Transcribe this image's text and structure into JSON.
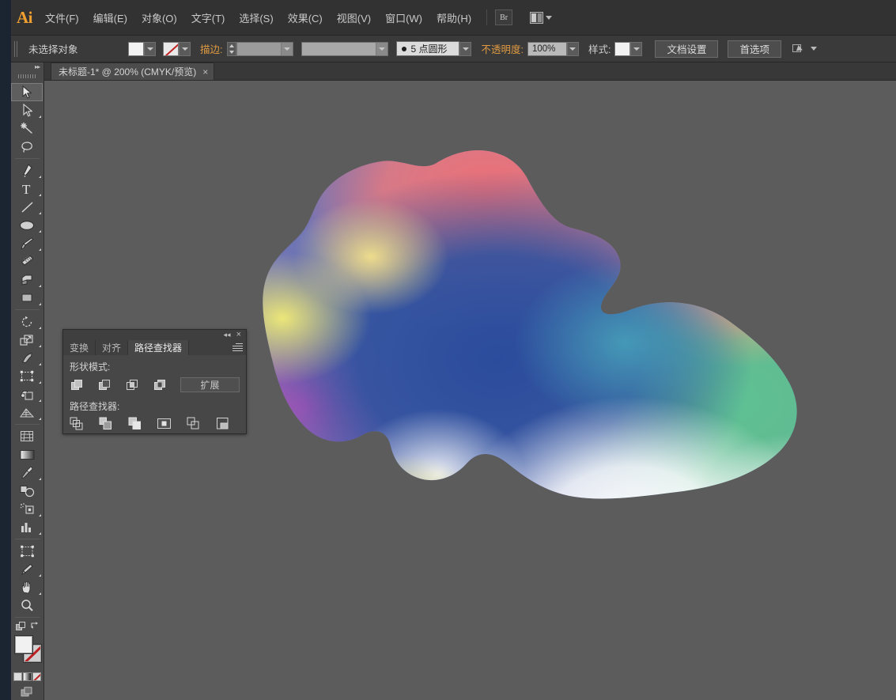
{
  "app": {
    "name": "Adobe Illustrator",
    "logo_text": "Ai"
  },
  "menubar": {
    "items": [
      {
        "label": "文件(F)",
        "name": "menu-file"
      },
      {
        "label": "编辑(E)",
        "name": "menu-edit"
      },
      {
        "label": "对象(O)",
        "name": "menu-object"
      },
      {
        "label": "文字(T)",
        "name": "menu-type"
      },
      {
        "label": "选择(S)",
        "name": "menu-select"
      },
      {
        "label": "效果(C)",
        "name": "menu-effect"
      },
      {
        "label": "视图(V)",
        "name": "menu-view"
      },
      {
        "label": "窗口(W)",
        "name": "menu-window"
      },
      {
        "label": "帮助(H)",
        "name": "menu-help"
      }
    ],
    "bridge_label": "Br",
    "arrange_label": ""
  },
  "controlbar": {
    "selection_status": "未选择对象",
    "stroke_label": "描边:",
    "stroke_weight": "",
    "profile_label": "5 点圆形",
    "opacity_label": "不透明度:",
    "opacity_value": "100%",
    "style_label": "样式:",
    "document_setup": "文档设置",
    "preferences": "首选项"
  },
  "tabbar": {
    "tabs": [
      {
        "title": "未标题-1* @ 200% (CMYK/预览)",
        "close": "×"
      }
    ]
  },
  "toolbar": {
    "collapse": "▸▸",
    "tools": [
      {
        "name": "selection-tool",
        "label": "选择工具",
        "selected": true,
        "sub": false
      },
      {
        "name": "direct-selection-tool",
        "label": "直接选择工具",
        "selected": false,
        "sub": true
      },
      {
        "name": "magic-wand-tool",
        "label": "魔棒工具",
        "selected": false,
        "sub": false
      },
      {
        "name": "lasso-tool",
        "label": "套索工具",
        "selected": false,
        "sub": false
      },
      {
        "name": "pen-tool",
        "label": "钢笔工具",
        "selected": false,
        "sub": true
      },
      {
        "name": "type-tool",
        "label": "文字工具",
        "selected": false,
        "sub": true
      },
      {
        "name": "line-segment-tool",
        "label": "直线段工具",
        "selected": false,
        "sub": true
      },
      {
        "name": "ellipse-tool",
        "label": "椭圆工具",
        "selected": false,
        "sub": true
      },
      {
        "name": "paintbrush-tool",
        "label": "画笔工具",
        "selected": false,
        "sub": true
      },
      {
        "name": "blob-brush-tool",
        "label": "斑点画笔工具",
        "selected": false,
        "sub": false
      },
      {
        "name": "eraser-tool",
        "label": "橡皮擦工具",
        "selected": false,
        "sub": true
      },
      {
        "name": "rotate-tool",
        "label": "旋转工具",
        "selected": false,
        "sub": true
      },
      {
        "name": "scale-tool",
        "label": "缩放工具",
        "selected": false,
        "sub": true
      },
      {
        "name": "width-tool",
        "label": "宽度工具",
        "selected": false,
        "sub": true
      },
      {
        "name": "free-transform-tool",
        "label": "自由变换工具",
        "selected": false,
        "sub": false
      },
      {
        "name": "shape-builder-tool",
        "label": "形状生成器工具",
        "selected": false,
        "sub": true
      },
      {
        "name": "perspective-grid-tool",
        "label": "透视网格工具",
        "selected": false,
        "sub": true
      },
      {
        "name": "mesh-tool",
        "label": "网格工具",
        "selected": false,
        "sub": false
      },
      {
        "name": "gradient-tool",
        "label": "渐变工具",
        "selected": false,
        "sub": false
      },
      {
        "name": "eyedropper-tool",
        "label": "吸管工具",
        "selected": false,
        "sub": true
      },
      {
        "name": "blend-tool",
        "label": "混合工具",
        "selected": false,
        "sub": false
      },
      {
        "name": "symbol-sprayer-tool",
        "label": "符号喷枪工具",
        "selected": false,
        "sub": true
      },
      {
        "name": "column-graph-tool",
        "label": "柱形图工具",
        "selected": false,
        "sub": true
      },
      {
        "name": "artboard-tool",
        "label": "画板工具",
        "selected": false,
        "sub": false
      },
      {
        "name": "slice-tool",
        "label": "切片工具",
        "selected": false,
        "sub": true
      },
      {
        "name": "hand-tool",
        "label": "抓手工具",
        "selected": false,
        "sub": true
      },
      {
        "name": "zoom-tool",
        "label": "缩放工具",
        "selected": false,
        "sub": false
      }
    ],
    "colors": {
      "fill": "#f1f1f1",
      "stroke": "none",
      "fill_name": "填色",
      "stroke_name": "描边"
    }
  },
  "panel": {
    "tabs": [
      {
        "label": "变换",
        "active": false,
        "name": "panel-tab-transform"
      },
      {
        "label": "对齐",
        "active": false,
        "name": "panel-tab-align"
      },
      {
        "label": "路径查找器",
        "active": true,
        "name": "panel-tab-pathfinder"
      }
    ],
    "collapse_icon": "◂◂",
    "close_icon": "×",
    "shape_modes_label": "形状模式:",
    "expand_label": "扩展",
    "pathfinders_label": "路径查找器:",
    "shape_modes": [
      {
        "name": "unite-button",
        "label": "联集"
      },
      {
        "name": "minus-front-button",
        "label": "减去顶层"
      },
      {
        "name": "intersect-button",
        "label": "交集"
      },
      {
        "name": "exclude-button",
        "label": "差集"
      }
    ],
    "pathfinders": [
      {
        "name": "divide-button",
        "label": "分割"
      },
      {
        "name": "trim-button",
        "label": "修边"
      },
      {
        "name": "merge-button",
        "label": "合并"
      },
      {
        "name": "crop-button",
        "label": "裁剪"
      },
      {
        "name": "outline-button",
        "label": "轮廓"
      },
      {
        "name": "minus-back-button",
        "label": "减去后方对象"
      }
    ]
  },
  "canvas": {
    "background": "#5c5c5c",
    "artwork_name": "gradient-mesh-blob",
    "palette": {
      "pink": "#e87a7f",
      "salmon": "#e8a878",
      "blue": "#31529f",
      "green": "#5fbd8e",
      "magenta": "#c459b5",
      "yellow": "#e8e07a",
      "white": "#ffffff",
      "teal": "#3f9fbd"
    }
  }
}
